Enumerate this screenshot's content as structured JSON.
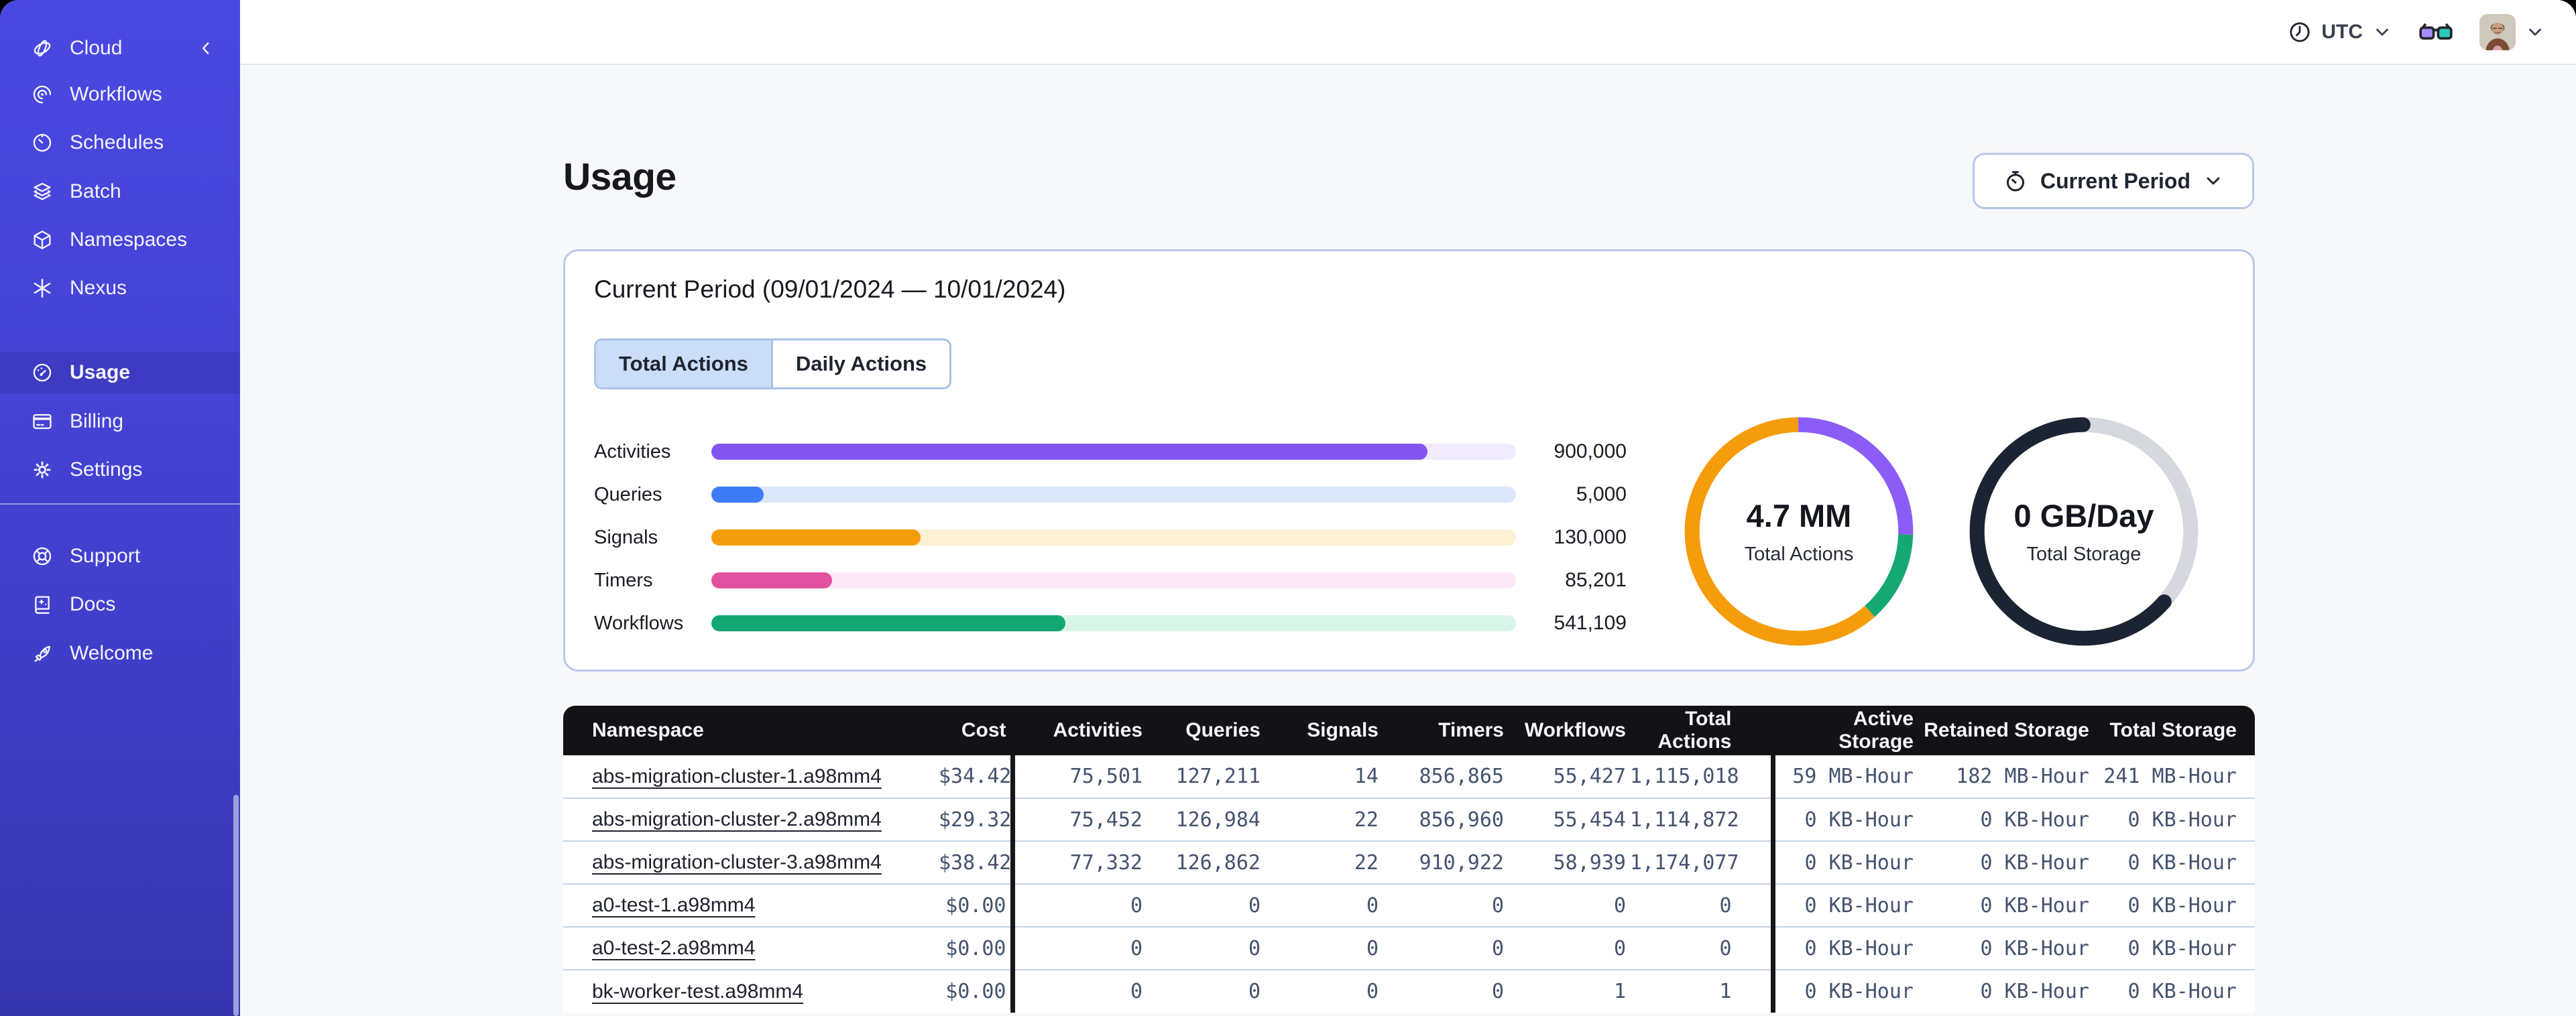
{
  "sidebar": {
    "header": {
      "label": "Cloud"
    },
    "groups": [
      {
        "items": [
          {
            "label": "Workflows"
          },
          {
            "label": "Schedules"
          },
          {
            "label": "Batch"
          },
          {
            "label": "Namespaces"
          },
          {
            "label": "Nexus"
          }
        ]
      },
      {
        "items": [
          {
            "label": "Usage",
            "active": true
          },
          {
            "label": "Billing"
          },
          {
            "label": "Settings"
          }
        ]
      },
      {
        "items": [
          {
            "label": "Support"
          },
          {
            "label": "Docs"
          },
          {
            "label": "Welcome"
          }
        ]
      }
    ]
  },
  "topbar": {
    "timezone": "UTC"
  },
  "page": {
    "title": "Usage",
    "period_button_label": "Current Period"
  },
  "card": {
    "title": "Current Period (09/01/2024 — 10/01/2024)",
    "tabs": [
      {
        "label": "Total Actions",
        "active": true
      },
      {
        "label": "Daily Actions",
        "active": false
      }
    ]
  },
  "chart_data": [
    {
      "type": "bar",
      "title": "Actions by type",
      "categories": [
        "Activities",
        "Queries",
        "Signals",
        "Timers",
        "Workflows"
      ],
      "values": [
        900000,
        5000,
        130000,
        85201,
        541109
      ],
      "value_labels": [
        "900,000",
        "5,000",
        "130,000",
        "85,201",
        "541,109"
      ],
      "fill_pct": [
        89,
        6.5,
        26,
        15,
        44
      ],
      "colors": [
        "#8355F0",
        "#3E7BF6",
        "#F59C0B",
        "#E2519F",
        "#13A873"
      ],
      "track_colors": [
        "#EFEBFD",
        "#DCE7FC",
        "#FCF1D2",
        "#FBE8F6",
        "#D8F6E8"
      ]
    },
    {
      "type": "pie",
      "name": "total-actions-donut",
      "center_value": "4.7 MM",
      "center_label": "Total Actions",
      "segments": [
        {
          "name": "activities",
          "color": "#8B5CF6",
          "pct": 25.5,
          "linecap": "butt"
        },
        {
          "name": "workflows",
          "color": "#15A873",
          "pct": 13,
          "linecap": "butt"
        },
        {
          "name": "signals",
          "color": "#F59C0B",
          "pct": 61.5,
          "linecap": "butt"
        }
      ]
    },
    {
      "type": "pie",
      "name": "total-storage-donut",
      "center_value": "0 GB/Day",
      "center_label": "Total Storage",
      "segments": [
        {
          "name": "retained",
          "color": "#D5D8DF",
          "pct": 36.5,
          "linecap": "butt"
        },
        {
          "name": "active",
          "color": "#1B2433",
          "pct": 63.5,
          "linecap": "round"
        }
      ]
    }
  ],
  "table": {
    "columns": [
      "Namespace",
      "Cost",
      "Activities",
      "Queries",
      "Signals",
      "Timers",
      "Workflows",
      "Total Actions",
      "Active Storage",
      "Retained Storage",
      "Total Storage"
    ],
    "rows": [
      [
        "abs-migration-cluster-1.a98mm4",
        "$34.42",
        "75,501",
        "127,211",
        "14",
        "856,865",
        "55,427",
        "1,115,018",
        "59 MB-Hour",
        "182 MB-Hour",
        "241 MB-Hour"
      ],
      [
        "abs-migration-cluster-2.a98mm4",
        "$29.32",
        "75,452",
        "126,984",
        "22",
        "856,960",
        "55,454",
        "1,114,872",
        "0 KB-Hour",
        "0 KB-Hour",
        "0 KB-Hour"
      ],
      [
        "abs-migration-cluster-3.a98mm4",
        "$38.42",
        "77,332",
        "126,862",
        "22",
        "910,922",
        "58,939",
        "1,174,077",
        "0 KB-Hour",
        "0 KB-Hour",
        "0 KB-Hour"
      ],
      [
        "a0-test-1.a98mm4",
        "$0.00",
        "0",
        "0",
        "0",
        "0",
        "0",
        "0",
        "0 KB-Hour",
        "0 KB-Hour",
        "0 KB-Hour"
      ],
      [
        "a0-test-2.a98mm4",
        "$0.00",
        "0",
        "0",
        "0",
        "0",
        "0",
        "0",
        "0 KB-Hour",
        "0 KB-Hour",
        "0 KB-Hour"
      ],
      [
        "bk-worker-test.a98mm4",
        "$0.00",
        "0",
        "0",
        "0",
        "0",
        "1",
        "1",
        "0 KB-Hour",
        "0 KB-Hour",
        "0 KB-Hour"
      ]
    ]
  }
}
